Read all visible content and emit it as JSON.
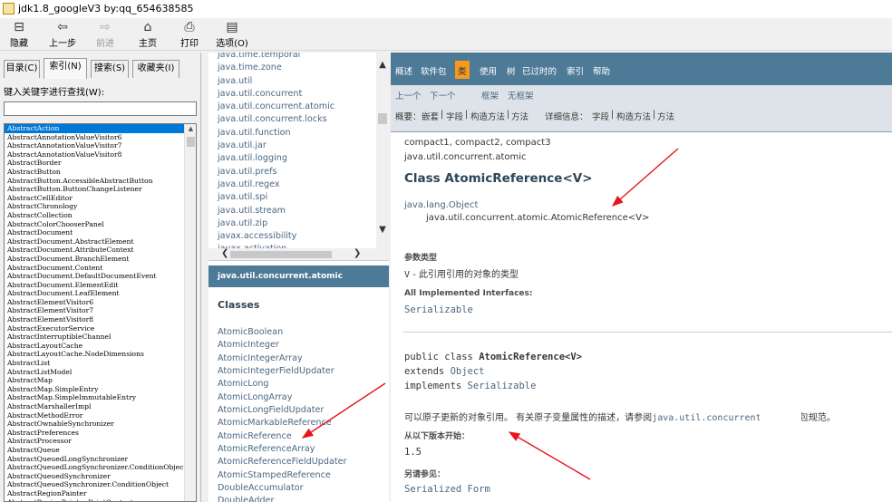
{
  "window": {
    "title": "jdk1.8_googleV3 by:qq_654638585",
    "icon": "chm-icon"
  },
  "toolbar": {
    "buttons": [
      {
        "label": "隐藏",
        "icon": "hide-icon"
      },
      {
        "label": "上一步",
        "icon": "back-icon"
      },
      {
        "label": "前进",
        "icon": "forward-icon",
        "disabled": true
      },
      {
        "label": "主页",
        "icon": "home-icon"
      },
      {
        "label": "打印",
        "icon": "print-icon"
      },
      {
        "label": "选项(O)",
        "icon": "options-icon"
      }
    ]
  },
  "left_panel": {
    "tabs": [
      "目录(C)",
      "索引(N)",
      "搜索(S)",
      "收藏夹(I)"
    ],
    "active_tab": "索引(N)",
    "keyword_label": "键入关键字进行查找(W):",
    "keyword_value": "",
    "index_items": [
      "AbstractAction",
      "AbstractAnnotationValueVisitor6",
      "AbstractAnnotationValueVisitor7",
      "AbstractAnnotationValueVisitor8",
      "AbstractBorder",
      "AbstractButton",
      "AbstractButton.AccessibleAbstractButton",
      "AbstractButton.ButtonChangeListener",
      "AbstractCellEditor",
      "AbstractChronology",
      "AbstractCollection",
      "AbstractColorChooserPanel",
      "AbstractDocument",
      "AbstractDocument.AbstractElement",
      "AbstractDocument.AttributeContext",
      "AbstractDocument.BranchElement",
      "AbstractDocument.Content",
      "AbstractDocument.DefaultDocumentEvent",
      "AbstractDocument.ElementEdit",
      "AbstractDocument.LeafElement",
      "AbstractElementVisitor6",
      "AbstractElementVisitor7",
      "AbstractElementVisitor8",
      "AbstractExecutorService",
      "AbstractInterruptibleChannel",
      "AbstractLayoutCache",
      "AbstractLayoutCache.NodeDimensions",
      "AbstractList",
      "AbstractListModel",
      "AbstractMap",
      "AbstractMap.SimpleEntry",
      "AbstractMap.SimpleImmutableEntry",
      "AbstractMarshallerImpl",
      "AbstractMethodError",
      "AbstractOwnableSynchronizer",
      "AbstractPreferences",
      "AbstractProcessor",
      "AbstractQueue",
      "AbstractQueuedLongSynchronizer",
      "AbstractQueuedLongSynchronizer.ConditionObject",
      "AbstractQueuedSynchronizer",
      "AbstractQueuedSynchronizer.ConditionObject",
      "AbstractRegionPainter",
      "AbstractRegionPainter.PaintContext"
    ],
    "selected_index_item": "AbstractAction"
  },
  "middle_panel": {
    "packages": [
      "java.time.temporal",
      "java.time.zone",
      "java.util",
      "java.util.concurrent",
      "java.util.concurrent.atomic",
      "java.util.concurrent.locks",
      "java.util.function",
      "java.util.jar",
      "java.util.logging",
      "java.util.prefs",
      "java.util.regex",
      "java.util.spi",
      "java.util.stream",
      "java.util.zip",
      "javax.accessibility",
      "javax.activation"
    ],
    "current_package": "java.util.concurrent.atomic",
    "classes_header": "Classes",
    "classes": [
      "AtomicBoolean",
      "AtomicInteger",
      "AtomicIntegerArray",
      "AtomicIntegerFieldUpdater",
      "AtomicLong",
      "AtomicLongArray",
      "AtomicLongFieldUpdater",
      "AtomicMarkableReference",
      "AtomicReference",
      "AtomicReferenceArray",
      "AtomicReferenceFieldUpdater",
      "AtomicStampedReference",
      "DoubleAccumulator",
      "DoubleAdder"
    ]
  },
  "doc": {
    "nav": [
      "概述",
      "软件包",
      "类",
      "使用",
      "树",
      "已过时的",
      "索引",
      "帮助"
    ],
    "nav_active": "类",
    "sub1": [
      "上一个",
      "下一个",
      "框架",
      "无框架"
    ],
    "summary_label": "概要：",
    "summary_items": [
      "嵌套",
      "字段",
      "构造方法",
      "方法"
    ],
    "detail_label": "详细信息：",
    "detail_items": [
      "字段",
      "构造方法",
      "方法"
    ],
    "profiles": "compact1, compact2, compact3",
    "package": "java.util.concurrent.atomic",
    "class_title": "Class AtomicReference<V>",
    "inherit_parent": "java.lang.Object",
    "inherit_child": "java.util.concurrent.atomic.AtomicReference<V>",
    "type_params_label": "参数类型",
    "type_param": "V",
    "type_param_desc": " - 此引用引用的对象的类型",
    "impl_label": "All Implemented Interfaces:",
    "impl_value": "Serializable",
    "decl_prefix": "public class ",
    "decl_name": "AtomicReference<V>",
    "extends_kw": "extends ",
    "extends_val": "Object",
    "implements_kw": "implements ",
    "implements_val": "Serializable",
    "desc_prefix": "可以原子更新的对象引用。 有关原子变量属性的描述，请参阅",
    "desc_link": "java.util.concurrent.atomic",
    "desc_suffix": "包规范。",
    "since_label": "从以下版本开始：",
    "since_value": "1.5",
    "see_label": "另请参见：",
    "see_value": "Serialized Form"
  },
  "colors": {
    "nav_bar": "#4d7a97",
    "nav_active": "#f8981d",
    "subnav": "#dee3e9",
    "link": "#4a6782",
    "selection": "#0078d7",
    "annotation": "#e8141c"
  }
}
